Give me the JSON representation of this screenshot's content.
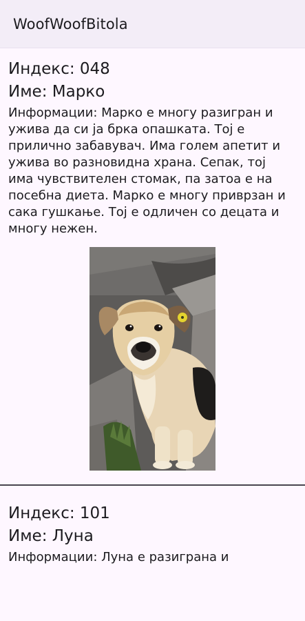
{
  "app_bar": {
    "title": "WoofWoofBitola"
  },
  "dogs": [
    {
      "index_text": "Индекс: 048",
      "name_text": "Име: Марко",
      "info_text": "Информации: Марко е многу разигран и ужива да си ја брка опашката. Тој е прилично забавувач. Има голем апетит и ужива во разновидна храна. Сепак, тој има чувствителен стомак, па затоа е на посебна диета. Марко е многу приврзан и сака гушкање. Тој е одличен со децата и многу нежен.",
      "photo_subject": "dog-photo"
    },
    {
      "index_text": "Индекс: 101",
      "name_text": "Име: Луна",
      "info_text": "Информации: Луна е разиграна и"
    }
  ],
  "colors": {
    "background": "#fef7ff",
    "app_bar": "#f3edf7",
    "text": "#1c1b1f",
    "divider": "#49454f"
  }
}
